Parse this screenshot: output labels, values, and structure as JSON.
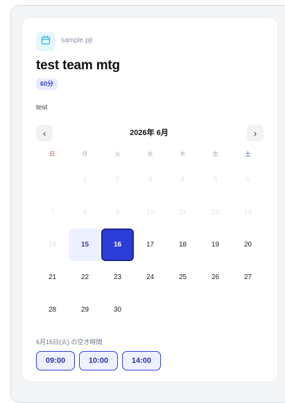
{
  "project": {
    "icon": "calendar-icon",
    "name": "sample pjt"
  },
  "event": {
    "title": "test team mtg",
    "duration": "60分",
    "description": "test"
  },
  "calendar": {
    "month_label": "2026年 6月",
    "prev_icon": "chevron-left-icon",
    "next_icon": "chevron-right-icon",
    "prev_label": "‹",
    "next_label": "›",
    "weekdays": [
      "日",
      "月",
      "火",
      "水",
      "木",
      "金",
      "土"
    ],
    "days": [
      {
        "label": "1",
        "state": "disabled"
      },
      {
        "label": "2",
        "state": "disabled"
      },
      {
        "label": "3",
        "state": "disabled"
      },
      {
        "label": "4",
        "state": "disabled"
      },
      {
        "label": "5",
        "state": "disabled"
      },
      {
        "label": "6",
        "state": "disabled"
      },
      {
        "label": "7",
        "state": "disabled"
      },
      {
        "label": "8",
        "state": "disabled"
      },
      {
        "label": "9",
        "state": "disabled"
      },
      {
        "label": "10",
        "state": "disabled"
      },
      {
        "label": "11",
        "state": "disabled"
      },
      {
        "label": "12",
        "state": "disabled"
      },
      {
        "label": "13",
        "state": "disabled"
      },
      {
        "label": "14",
        "state": "disabled"
      },
      {
        "label": "15",
        "state": "available"
      },
      {
        "label": "16",
        "state": "selected"
      },
      {
        "label": "17",
        "state": "normal"
      },
      {
        "label": "18",
        "state": "normal"
      },
      {
        "label": "19",
        "state": "normal"
      },
      {
        "label": "20",
        "state": "normal"
      },
      {
        "label": "21",
        "state": "normal"
      },
      {
        "label": "22",
        "state": "normal"
      },
      {
        "label": "23",
        "state": "normal"
      },
      {
        "label": "24",
        "state": "normal"
      },
      {
        "label": "25",
        "state": "normal"
      },
      {
        "label": "26",
        "state": "normal"
      },
      {
        "label": "27",
        "state": "normal"
      },
      {
        "label": "28",
        "state": "normal"
      },
      {
        "label": "29",
        "state": "normal"
      },
      {
        "label": "30",
        "state": "normal"
      }
    ]
  },
  "slots": {
    "heading": "6月16日(火) の空き時間",
    "times": [
      "09:00",
      "10:00",
      "14:00"
    ]
  },
  "colors": {
    "accent": "#2c3cd6",
    "accent_light": "#edf0fe",
    "sunday": "#e23d3d",
    "saturday": "#3a5bd9",
    "icon_bg": "#e5f7fb",
    "icon_stroke": "#22b8d6"
  }
}
